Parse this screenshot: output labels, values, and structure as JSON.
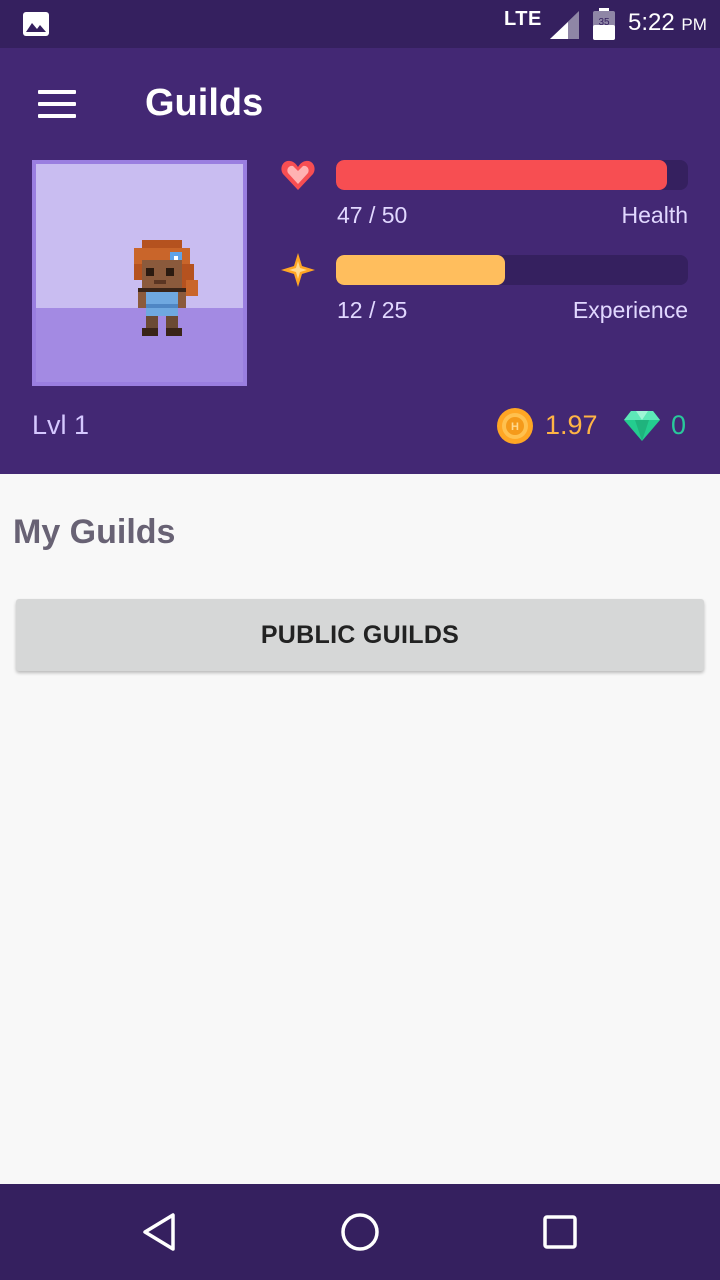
{
  "status_bar": {
    "network": "LTE",
    "battery_level": "35",
    "time": "5:22",
    "ampm": "PM"
  },
  "header": {
    "title": "Guilds",
    "health": {
      "value_text": "47 / 50",
      "label": "Health",
      "current": 47,
      "max": 50,
      "color": "#f74e52"
    },
    "experience": {
      "value_text": "12 / 25",
      "label": "Experience",
      "current": 12,
      "max": 25,
      "color": "#ffbe5d"
    },
    "level": "Lvl 1",
    "gold": "1.97",
    "gems": "0"
  },
  "main": {
    "section_title": "My Guilds",
    "public_guilds_button": "PUBLIC GUILDS"
  },
  "icons": {
    "menu": "hamburger-menu-icon",
    "health": "heart-icon",
    "experience": "star-icon",
    "gold": "gold-coin-icon",
    "gem": "gem-icon",
    "back": "back-icon",
    "home": "home-icon",
    "recents": "recents-icon"
  },
  "colors": {
    "status_bar": "#35205f",
    "header": "#432874",
    "accent_gold": "#ffb445",
    "accent_gem": "#29c99b"
  }
}
